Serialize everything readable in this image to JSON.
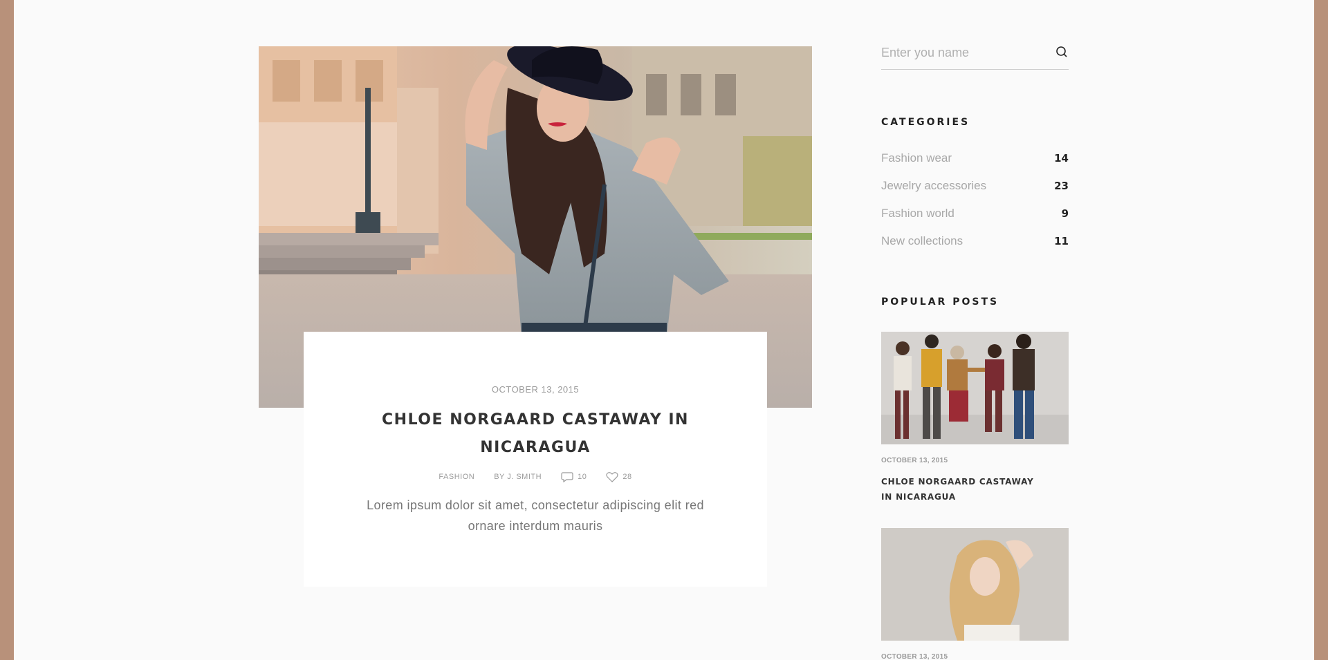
{
  "main_post": {
    "date": "OCTOBER 13, 2015",
    "title": "CHLOE NORGAARD CASTAWAY IN NICARAGUA",
    "category": "FASHION",
    "author": "BY J. SMITH",
    "comments": "10",
    "likes": "28",
    "excerpt": "Lorem ipsum dolor sit amet, consectetur adipiscing elit red ornare interdum mauris"
  },
  "sidebar": {
    "search": {
      "placeholder": "Enter you name"
    },
    "categories": {
      "title": "CATEGORIES",
      "items": [
        {
          "label": "Fashion wear",
          "count": "14"
        },
        {
          "label": "Jewelry accessories",
          "count": "23"
        },
        {
          "label": "Fashion world",
          "count": "9"
        },
        {
          "label": "New collections",
          "count": "11"
        }
      ]
    },
    "popular_posts": {
      "title": "POPULAR POSTS",
      "items": [
        {
          "date": "OCTOBER 13, 2015",
          "title": "CHLOE NORGAARD CASTAWAY IN NICARAGUA"
        },
        {
          "date": "OCTOBER 13, 2015"
        }
      ]
    }
  },
  "colors": {
    "frame": "#b8917a",
    "page_bg": "#fafafa",
    "card_bg": "#ffffff",
    "muted_text": "#9a9a9a"
  },
  "icons": {
    "search": "search-icon",
    "comment": "comment-icon",
    "like": "heart-icon"
  }
}
